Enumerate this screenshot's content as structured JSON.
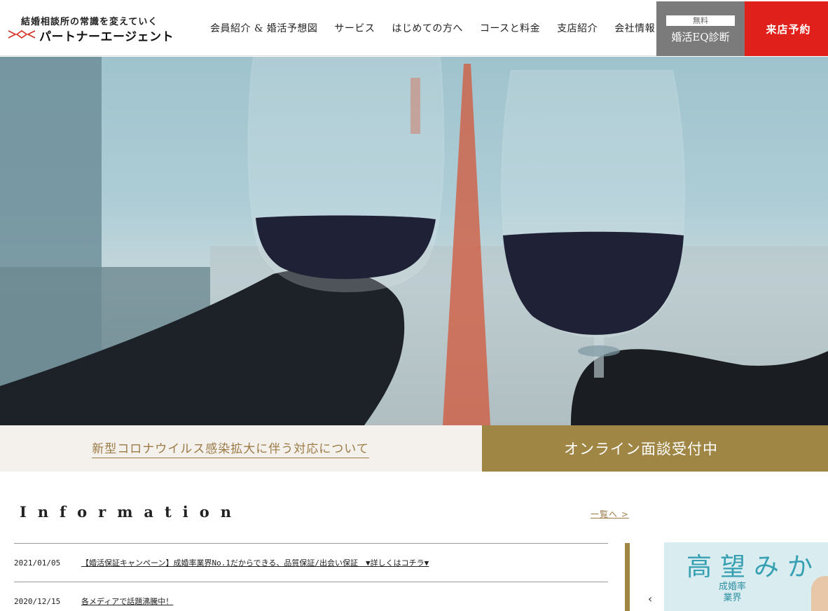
{
  "header": {
    "tagline": "結婚相談所の常識を変えていく",
    "brand": "パートナーエージェント",
    "nav": [
      "会員紹介 & 婚活予想図",
      "サービス",
      "はじめての方へ",
      "コースと料金",
      "支店紹介",
      "会社情報"
    ],
    "eq_badge": "無料",
    "eq_label": "婚活EQ診断",
    "visit_label": "来店予約"
  },
  "banners": {
    "covid": "新型コロナウイルス感染拡大に伴う対応について",
    "online": "オンライン面談受付中"
  },
  "information": {
    "heading": "Information",
    "more": "一覧へ >",
    "items": [
      {
        "date": "2021/01/05",
        "title": "【婚活保証キャンペーン】成婚率業界No.1だからできる、品質保証/出会い保証　▼詳しくはコチラ▼"
      },
      {
        "date": "2020/12/15",
        "title": "各メディアで話題沸騰中！"
      }
    ]
  },
  "promo": {
    "big_text": "高望みか",
    "small_line1": "成婚率",
    "small_line2": "業界",
    "prev_icon": "chevron-left-icon"
  },
  "colors": {
    "accent_gold": "#a08644",
    "accent_red": "#e0201a",
    "eq_gray": "#7b7b7b"
  }
}
